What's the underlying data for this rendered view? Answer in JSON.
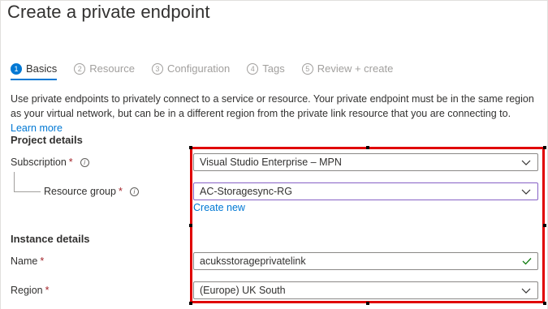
{
  "page": {
    "title": "Create a private endpoint"
  },
  "tabs": [
    {
      "num": "1",
      "label": "Basics",
      "active": true
    },
    {
      "num": "2",
      "label": "Resource",
      "active": false
    },
    {
      "num": "3",
      "label": "Configuration",
      "active": false
    },
    {
      "num": "4",
      "label": "Tags",
      "active": false
    },
    {
      "num": "5",
      "label": "Review + create",
      "active": false
    }
  ],
  "description": {
    "text": "Use private endpoints to privately connect to a service or resource. Your private endpoint must be in the same region as your virtual network, but can be in a different region from the private link resource that you are connecting to.",
    "link": "Learn more"
  },
  "project_details": {
    "heading": "Project details",
    "subscription": {
      "label": "Subscription",
      "required": "*",
      "value": "Visual Studio Enterprise – MPN"
    },
    "resource_group": {
      "label": "Resource group",
      "required": "*",
      "value": "AC-Storagesync-RG",
      "create_new": "Create new"
    }
  },
  "instance_details": {
    "heading": "Instance details",
    "name": {
      "label": "Name",
      "required": "*",
      "value": "acuksstorageprivatelink"
    },
    "region": {
      "label": "Region",
      "required": "*",
      "value": "(Europe) UK South"
    }
  },
  "colors": {
    "accent": "#0078d4",
    "highlight": "#e00000",
    "required": "#a4262c",
    "valid": "#107c10"
  }
}
